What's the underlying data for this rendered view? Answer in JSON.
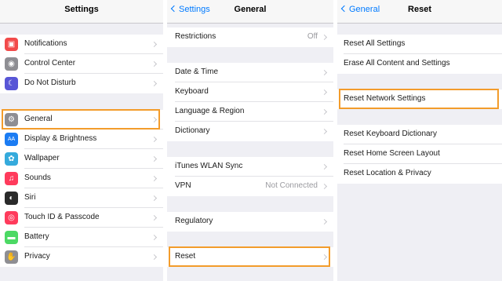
{
  "settings": {
    "title": "Settings",
    "groups": [
      [
        {
          "label": "Notifications",
          "icon": "notifications-icon",
          "color": "#f24a4a",
          "glyph": "▣"
        },
        {
          "label": "Control Center",
          "icon": "control-center-icon",
          "color": "#8e8e93",
          "glyph": "◉"
        },
        {
          "label": "Do Not Disturb",
          "icon": "moon-icon",
          "color": "#5856d6",
          "glyph": "☾"
        }
      ],
      [
        {
          "label": "General",
          "icon": "gear-icon",
          "color": "#8e8e93",
          "glyph": "⚙"
        },
        {
          "label": "Display & Brightness",
          "icon": "display-icon",
          "color": "#1b7cf3",
          "glyph": "AA"
        },
        {
          "label": "Wallpaper",
          "icon": "wallpaper-icon",
          "color": "#35aadc",
          "glyph": "✿"
        },
        {
          "label": "Sounds",
          "icon": "sounds-icon",
          "color": "#ff3b5c",
          "glyph": "♫"
        },
        {
          "label": "Siri",
          "icon": "siri-icon",
          "color": "#2a2a2a",
          "glyph": "◐"
        },
        {
          "label": "Touch ID & Passcode",
          "icon": "fingerprint-icon",
          "color": "#ff3b5c",
          "glyph": "◎"
        },
        {
          "label": "Battery",
          "icon": "battery-icon",
          "color": "#4cd964",
          "glyph": "▬"
        },
        {
          "label": "Privacy",
          "icon": "privacy-icon",
          "color": "#8e8e93",
          "glyph": "✋"
        }
      ]
    ]
  },
  "general": {
    "back": "Settings",
    "title": "General",
    "groups": [
      [
        {
          "label": "Restrictions",
          "value": "Off"
        }
      ],
      [
        {
          "label": "Date & Time"
        },
        {
          "label": "Keyboard"
        },
        {
          "label": "Language & Region"
        },
        {
          "label": "Dictionary"
        }
      ],
      [
        {
          "label": "iTunes WLAN Sync"
        },
        {
          "label": "VPN",
          "value": "Not Connected"
        }
      ],
      [
        {
          "label": "Regulatory"
        }
      ],
      [
        {
          "label": "Reset"
        }
      ]
    ]
  },
  "reset": {
    "back": "General",
    "title": "Reset",
    "groups": [
      [
        {
          "label": "Reset All Settings"
        },
        {
          "label": "Erase All Content and Settings"
        }
      ],
      [
        {
          "label": "Reset Network Settings"
        }
      ],
      [
        {
          "label": "Reset Keyboard Dictionary"
        },
        {
          "label": "Reset Home Screen Layout"
        },
        {
          "label": "Reset Location & Privacy"
        }
      ]
    ]
  },
  "highlight_color": "#f39c2b"
}
